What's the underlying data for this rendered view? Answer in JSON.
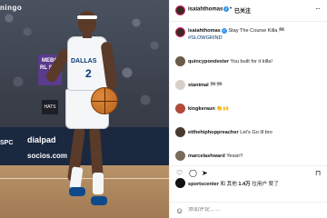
{
  "photo": {
    "signal_tag": "ningo",
    "brand_tile": "MEBO RL SPC",
    "hat_sign": "HATS",
    "jersey_word": "DALLAS",
    "jersey_number": "2",
    "ad_left": "SPC",
    "ad_mid": "dialpad",
    "ad_low": "socios.com"
  },
  "header": {
    "username": "isaiahthomas",
    "separator": "•",
    "follow": "已关注",
    "more": "···"
  },
  "caption": {
    "user": "isaiahthomas",
    "text": "Stay The Course Killa 🏁",
    "hashtag": "#SLOWGRIND"
  },
  "comments": [
    {
      "user": "quincypondexter",
      "text": "You built for it killa!"
    },
    {
      "user": "stanimal",
      "text": "🏁🏁"
    },
    {
      "user": "kingkeraun",
      "text": "👏🙌"
    },
    {
      "user": "etthehiphoppreacher",
      "text": "Let's Go lil bro"
    },
    {
      "user": "marcelashward",
      "text": "Yessir!!"
    }
  ],
  "actions": {
    "like_icon": "heart-icon",
    "comment_icon": "comment-icon",
    "share_icon": "send-icon",
    "save_icon": "bookmark-icon"
  },
  "liked_by": {
    "user": "sportscenter",
    "middle": "和 其他",
    "count": "1.4万",
    "suffix": "位用户 赞了"
  },
  "add_comment": {
    "placeholder": "添加评论……"
  },
  "colors": {
    "story_ring": "#d62976",
    "verified": "#3897f0",
    "hashtag": "#00376b"
  }
}
